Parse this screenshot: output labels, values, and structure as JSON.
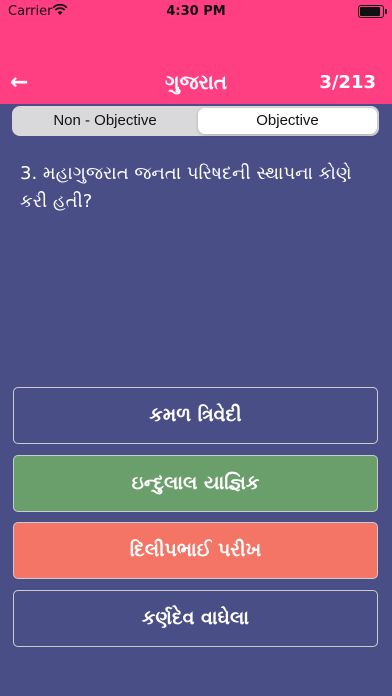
{
  "status_bar": {
    "carrier": "Carrier",
    "time": "4:30 PM",
    "wifi_icon": "wifi-icon",
    "battery_icon": "battery-icon"
  },
  "nav": {
    "back_icon": "arrow-left-icon",
    "back_glyph": "←",
    "title": "ગુજરાત",
    "counter": "3/213"
  },
  "tabs": [
    {
      "label": "Non - Objective",
      "selected": false
    },
    {
      "label": "Objective",
      "selected": true
    }
  ],
  "question": {
    "text": "3. મહાગુજરાત જનતા પરિષદની સ્થાપના કોણે કરી હતી?"
  },
  "options": [
    {
      "label": "કમળ ત્રિવેદી",
      "state": "default"
    },
    {
      "label": "ઇન્દુલાલ યાજ્ઞિક",
      "state": "correct"
    },
    {
      "label": "દિલીપભાઈ પરીખ",
      "state": "wrong"
    },
    {
      "label": "કર્ણદેવ વાઘેલા",
      "state": "default"
    }
  ],
  "colors": {
    "header": "#ff3f82",
    "background": "#4a4e86",
    "correct": "#6a9e6a",
    "wrong": "#f47466"
  }
}
